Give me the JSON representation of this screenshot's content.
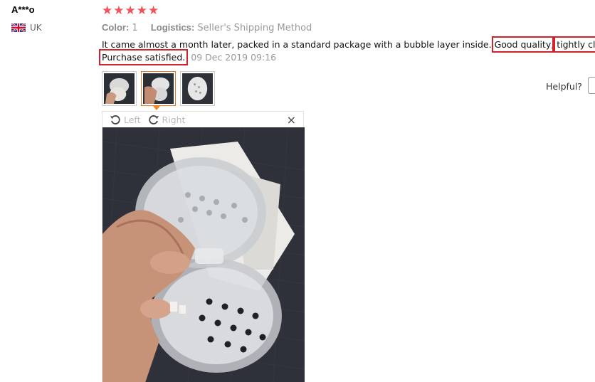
{
  "user": {
    "name": "A***o",
    "country": "UK"
  },
  "rating": {
    "stars": 5,
    "glyph": "★",
    "color": "#f0515b"
  },
  "meta": {
    "color_label": "Color:",
    "color_value": "1",
    "logistics_label": "Logistics:",
    "logistics_value": "Seller's Shipping Method"
  },
  "review": {
    "part1": "It came almost a month later, packed in a standard package with a bubble layer inside.",
    "hl1": "Good quality",
    "sep": ",",
    "hl2": "tightly closed.",
    "hl3": "Purchase satisfied.",
    "date": "09 Dec 2019 09:16"
  },
  "helpful": {
    "label": "Helpful?"
  },
  "viewer": {
    "rotate_left": "Left",
    "rotate_right": "Right",
    "close": "×"
  },
  "colors": {
    "highlight": "#d3232a",
    "active_thumb": "#e07b2a"
  }
}
